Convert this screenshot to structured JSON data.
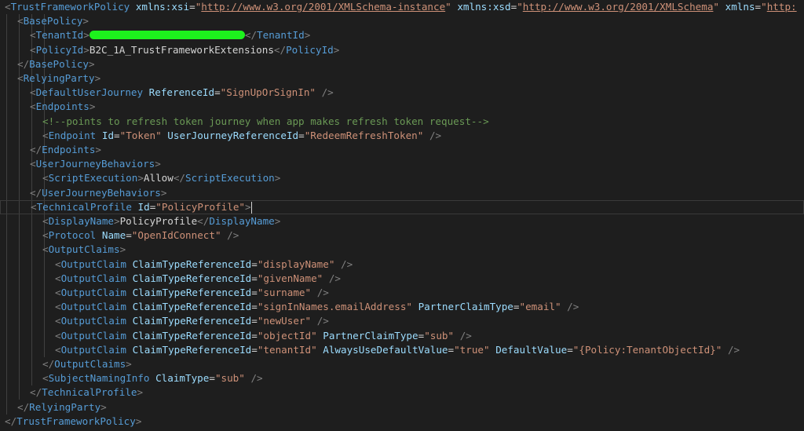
{
  "colors": {
    "background": "#1e1e1e",
    "punct": "#808080",
    "tag": "#569cd6",
    "attr": "#9cdcfe",
    "string": "#ce9178",
    "text": "#d4d4d4",
    "comment": "#6a9955",
    "url": "#ce9178"
  },
  "lines": [
    {
      "tokens": [
        [
          "punct",
          "<"
        ],
        [
          "tag",
          "TrustFrameworkPolicy"
        ],
        [
          "text",
          " "
        ],
        [
          "attr",
          "xmlns:xsi"
        ],
        [
          "text",
          "="
        ],
        [
          "string",
          "\""
        ],
        [
          "url",
          "http://www.w3.org/2001/XMLSchema-instance"
        ],
        [
          "string",
          "\""
        ],
        [
          "text",
          " "
        ],
        [
          "attr",
          "xmlns:xsd"
        ],
        [
          "text",
          "="
        ],
        [
          "string",
          "\""
        ],
        [
          "url",
          "http://www.w3.org/2001/XMLSchema"
        ],
        [
          "string",
          "\""
        ],
        [
          "text",
          " "
        ],
        [
          "attr",
          "xmlns"
        ],
        [
          "text",
          "="
        ],
        [
          "string",
          "\""
        ],
        [
          "url",
          "http:"
        ]
      ]
    },
    {
      "tokens": [
        [
          "punct",
          "<"
        ],
        [
          "tag",
          "BasePolicy"
        ],
        [
          "punct",
          ">"
        ]
      ]
    },
    {
      "tokens": [
        [
          "punct",
          "<"
        ],
        [
          "tag",
          "TenantId"
        ],
        [
          "punct",
          ">"
        ],
        [
          "redact",
          ""
        ],
        [
          "punct",
          "</"
        ],
        [
          "tag",
          "TenantId"
        ],
        [
          "punct",
          ">"
        ]
      ]
    },
    {
      "tokens": [
        [
          "punct",
          "<"
        ],
        [
          "tag",
          "PolicyId"
        ],
        [
          "punct",
          ">"
        ],
        [
          "text",
          "B2C_1A_TrustFrameworkExtensions"
        ],
        [
          "punct",
          "</"
        ],
        [
          "tag",
          "PolicyId"
        ],
        [
          "punct",
          ">"
        ]
      ]
    },
    {
      "tokens": [
        [
          "punct",
          "</"
        ],
        [
          "tag",
          "BasePolicy"
        ],
        [
          "punct",
          ">"
        ]
      ]
    },
    {
      "tokens": [
        [
          "punct",
          "<"
        ],
        [
          "tag",
          "RelyingParty"
        ],
        [
          "punct",
          ">"
        ]
      ]
    },
    {
      "tokens": [
        [
          "punct",
          "<"
        ],
        [
          "tag",
          "DefaultUserJourney"
        ],
        [
          "text",
          " "
        ],
        [
          "attr",
          "ReferenceId"
        ],
        [
          "text",
          "="
        ],
        [
          "string",
          "\"SignUpOrSignIn\""
        ],
        [
          "text",
          " "
        ],
        [
          "punct",
          "/>"
        ]
      ]
    },
    {
      "tokens": [
        [
          "punct",
          "<"
        ],
        [
          "tag",
          "Endpoints"
        ],
        [
          "punct",
          ">"
        ]
      ]
    },
    {
      "tokens": [
        [
          "comment",
          "<!--points to refresh token journey when app makes refresh token request-->"
        ]
      ]
    },
    {
      "tokens": [
        [
          "punct",
          "<"
        ],
        [
          "tag",
          "Endpoint"
        ],
        [
          "text",
          " "
        ],
        [
          "attr",
          "Id"
        ],
        [
          "text",
          "="
        ],
        [
          "string",
          "\"Token\""
        ],
        [
          "text",
          " "
        ],
        [
          "attr",
          "UserJourneyReferenceId"
        ],
        [
          "text",
          "="
        ],
        [
          "string",
          "\"RedeemRefreshToken\""
        ],
        [
          "text",
          " "
        ],
        [
          "punct",
          "/>"
        ]
      ]
    },
    {
      "tokens": [
        [
          "punct",
          "</"
        ],
        [
          "tag",
          "Endpoints"
        ],
        [
          "punct",
          ">"
        ]
      ]
    },
    {
      "tokens": [
        [
          "punct",
          "<"
        ],
        [
          "tag",
          "UserJourneyBehaviors"
        ],
        [
          "punct",
          ">"
        ]
      ]
    },
    {
      "tokens": [
        [
          "punct",
          "<"
        ],
        [
          "tag",
          "ScriptExecution"
        ],
        [
          "punct",
          ">"
        ],
        [
          "text",
          "Allow"
        ],
        [
          "punct",
          "</"
        ],
        [
          "tag",
          "ScriptExecution"
        ],
        [
          "punct",
          ">"
        ]
      ]
    },
    {
      "tokens": [
        [
          "punct",
          "</"
        ],
        [
          "tag",
          "UserJourneyBehaviors"
        ],
        [
          "punct",
          ">"
        ]
      ]
    },
    {
      "tokens": [
        [
          "punct",
          "<"
        ],
        [
          "tag",
          "TechnicalProfile"
        ],
        [
          "text",
          " "
        ],
        [
          "attr",
          "Id"
        ],
        [
          "text",
          "="
        ],
        [
          "string",
          "\"PolicyProfile\""
        ],
        [
          "punct",
          ">"
        ],
        [
          "caret",
          ""
        ]
      ]
    },
    {
      "tokens": [
        [
          "punct",
          "<"
        ],
        [
          "tag",
          "DisplayName"
        ],
        [
          "punct",
          ">"
        ],
        [
          "text",
          "PolicyProfile"
        ],
        [
          "punct",
          "</"
        ],
        [
          "tag",
          "DisplayName"
        ],
        [
          "punct",
          ">"
        ]
      ]
    },
    {
      "tokens": [
        [
          "punct",
          "<"
        ],
        [
          "tag",
          "Protocol"
        ],
        [
          "text",
          " "
        ],
        [
          "attr",
          "Name"
        ],
        [
          "text",
          "="
        ],
        [
          "string",
          "\"OpenIdConnect\""
        ],
        [
          "text",
          " "
        ],
        [
          "punct",
          "/>"
        ]
      ]
    },
    {
      "tokens": [
        [
          "punct",
          "<"
        ],
        [
          "tag",
          "OutputClaims"
        ],
        [
          "punct",
          ">"
        ]
      ]
    },
    {
      "tokens": [
        [
          "punct",
          "<"
        ],
        [
          "tag",
          "OutputClaim"
        ],
        [
          "text",
          " "
        ],
        [
          "attr",
          "ClaimTypeReferenceId"
        ],
        [
          "text",
          "="
        ],
        [
          "string",
          "\"displayName\""
        ],
        [
          "text",
          " "
        ],
        [
          "punct",
          "/>"
        ]
      ]
    },
    {
      "tokens": [
        [
          "punct",
          "<"
        ],
        [
          "tag",
          "OutputClaim"
        ],
        [
          "text",
          " "
        ],
        [
          "attr",
          "ClaimTypeReferenceId"
        ],
        [
          "text",
          "="
        ],
        [
          "string",
          "\"givenName\""
        ],
        [
          "text",
          " "
        ],
        [
          "punct",
          "/>"
        ]
      ]
    },
    {
      "tokens": [
        [
          "punct",
          "<"
        ],
        [
          "tag",
          "OutputClaim"
        ],
        [
          "text",
          " "
        ],
        [
          "attr",
          "ClaimTypeReferenceId"
        ],
        [
          "text",
          "="
        ],
        [
          "string",
          "\"surname\""
        ],
        [
          "text",
          " "
        ],
        [
          "punct",
          "/>"
        ]
      ]
    },
    {
      "tokens": [
        [
          "punct",
          "<"
        ],
        [
          "tag",
          "OutputClaim"
        ],
        [
          "text",
          " "
        ],
        [
          "attr",
          "ClaimTypeReferenceId"
        ],
        [
          "text",
          "="
        ],
        [
          "string",
          "\"signInNames.emailAddress\""
        ],
        [
          "text",
          " "
        ],
        [
          "attr",
          "PartnerClaimType"
        ],
        [
          "text",
          "="
        ],
        [
          "string",
          "\"email\""
        ],
        [
          "text",
          " "
        ],
        [
          "punct",
          "/>"
        ]
      ]
    },
    {
      "tokens": [
        [
          "punct",
          "<"
        ],
        [
          "tag",
          "OutputClaim"
        ],
        [
          "text",
          " "
        ],
        [
          "attr",
          "ClaimTypeReferenceId"
        ],
        [
          "text",
          "="
        ],
        [
          "string",
          "\"newUser\""
        ],
        [
          "text",
          " "
        ],
        [
          "punct",
          "/>"
        ]
      ]
    },
    {
      "tokens": [
        [
          "punct",
          "<"
        ],
        [
          "tag",
          "OutputClaim"
        ],
        [
          "text",
          " "
        ],
        [
          "attr",
          "ClaimTypeReferenceId"
        ],
        [
          "text",
          "="
        ],
        [
          "string",
          "\"objectId\""
        ],
        [
          "text",
          " "
        ],
        [
          "attr",
          "PartnerClaimType"
        ],
        [
          "text",
          "="
        ],
        [
          "string",
          "\"sub\""
        ],
        [
          "text",
          " "
        ],
        [
          "punct",
          "/>"
        ]
      ]
    },
    {
      "tokens": [
        [
          "punct",
          "<"
        ],
        [
          "tag",
          "OutputClaim"
        ],
        [
          "text",
          " "
        ],
        [
          "attr",
          "ClaimTypeReferenceId"
        ],
        [
          "text",
          "="
        ],
        [
          "string",
          "\"tenantId\""
        ],
        [
          "text",
          " "
        ],
        [
          "attr",
          "AlwaysUseDefaultValue"
        ],
        [
          "text",
          "="
        ],
        [
          "string",
          "\"true\""
        ],
        [
          "text",
          " "
        ],
        [
          "attr",
          "DefaultValue"
        ],
        [
          "text",
          "="
        ],
        [
          "string",
          "\"{Policy:TenantObjectId}\""
        ],
        [
          "text",
          " "
        ],
        [
          "punct",
          "/>"
        ]
      ]
    },
    {
      "tokens": [
        [
          "punct",
          "</"
        ],
        [
          "tag",
          "OutputClaims"
        ],
        [
          "punct",
          ">"
        ]
      ]
    },
    {
      "tokens": [
        [
          "punct",
          "<"
        ],
        [
          "tag",
          "SubjectNamingInfo"
        ],
        [
          "text",
          " "
        ],
        [
          "attr",
          "ClaimType"
        ],
        [
          "text",
          "="
        ],
        [
          "string",
          "\"sub\""
        ],
        [
          "text",
          " "
        ],
        [
          "punct",
          "/>"
        ]
      ]
    },
    {
      "tokens": [
        [
          "punct",
          "</"
        ],
        [
          "tag",
          "TechnicalProfile"
        ],
        [
          "punct",
          ">"
        ]
      ]
    },
    {
      "tokens": [
        [
          "punct",
          "</"
        ],
        [
          "tag",
          "RelyingParty"
        ],
        [
          "punct",
          ">"
        ]
      ]
    },
    {
      "tokens": [
        [
          "punct",
          "</"
        ],
        [
          "tag",
          "TrustFrameworkPolicy"
        ],
        [
          "punct",
          ">"
        ]
      ]
    }
  ]
}
